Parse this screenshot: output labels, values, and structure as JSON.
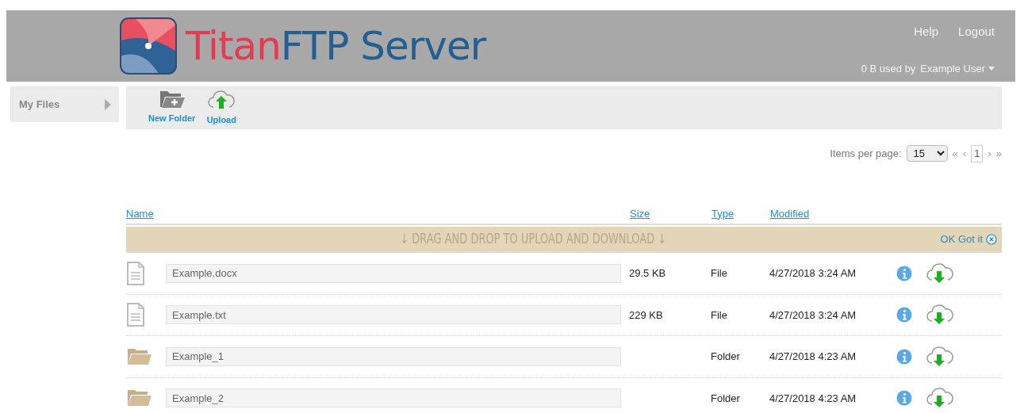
{
  "header": {
    "logo": {
      "brand": "Titan",
      "product": "FTP Server"
    },
    "links": [
      "Help",
      "Logout"
    ],
    "usage": "0 B used by",
    "user": "Example User"
  },
  "sidebar": {
    "items": [
      {
        "label": "My Files",
        "selected": true
      }
    ]
  },
  "toolbar": [
    {
      "kind": "folder",
      "label": "New Folder"
    },
    {
      "kind": "upload",
      "label": "Upload"
    }
  ],
  "pagination": {
    "label": "Items per page:",
    "per_page": "15",
    "first": "«",
    "prev": "‹",
    "page": "1",
    "next": "›",
    "last": "»"
  },
  "table": {
    "columns": [
      "Name",
      "Size",
      "Type",
      "Modified"
    ],
    "banner": {
      "text": "↓ DRAG AND DROP TO UPLOAD AND DOWNLOAD ↓",
      "dismiss": "OK Got it"
    },
    "rows": [
      {
        "kind": "file",
        "name": "Example.docx",
        "size": "29.5 KB",
        "type": "File",
        "modified": "4/27/2018 3:24 AM"
      },
      {
        "kind": "file",
        "name": "Example.txt",
        "size": "229 KB",
        "type": "File",
        "modified": "4/27/2018 3:24 AM"
      },
      {
        "kind": "folder",
        "name": "Example_1",
        "type": "Folder",
        "modified": "4/27/2018 4:23 AM"
      },
      {
        "kind": "folder",
        "name": "Example_2",
        "type": "Folder",
        "modified": "4/27/2018 4:23 AM"
      }
    ]
  }
}
